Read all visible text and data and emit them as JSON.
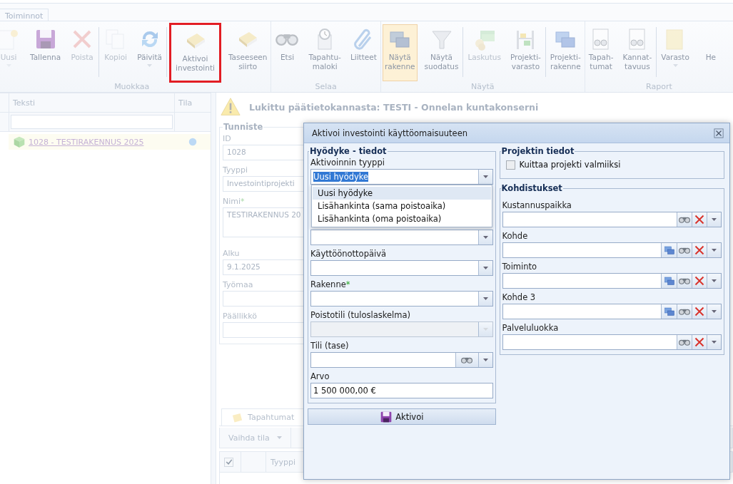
{
  "ribbon": {
    "tabs": [
      {
        "label": "Toiminnot",
        "selected": true
      }
    ],
    "groups": [
      {
        "label": "Muokkaa",
        "items": [
          {
            "label": "Uusi",
            "disabled": true,
            "selected": false,
            "dropdown": true
          },
          {
            "label": "Tallenna",
            "disabled": false,
            "selected": false
          },
          {
            "label": "Poista",
            "disabled": true,
            "selected": false
          },
          {
            "label": "Kopioi",
            "disabled": true,
            "selected": false,
            "separator_before": true
          },
          {
            "label": "Päivitä",
            "disabled": false,
            "selected": false,
            "dropdown": true
          },
          {
            "label": "Aktivoi\ninvestointi",
            "disabled": false,
            "selected": false,
            "separator_before": true,
            "highlighted": true
          },
          {
            "label": "Taseeseen\nsiirto",
            "disabled": false,
            "selected": false
          }
        ]
      },
      {
        "label": "Selaa",
        "items": [
          {
            "label": "Etsi",
            "disabled": false,
            "selected": false
          },
          {
            "label": "Tapahtu-\nmaloki",
            "disabled": false,
            "selected": false
          },
          {
            "label": "Liitteet",
            "disabled": false,
            "selected": false
          }
        ]
      },
      {
        "label": "Näytä",
        "items": [
          {
            "label": "Näytä\nrakenne",
            "disabled": false,
            "selected": true
          },
          {
            "label": "Näytä\nsuodatus",
            "disabled": false,
            "selected": false
          },
          {
            "label": "Laskutus",
            "disabled": true,
            "selected": false,
            "separator_before": true
          },
          {
            "label": "Projekti-\nvarasto",
            "disabled": false,
            "selected": false
          },
          {
            "label": "Projekti-\nrakenne",
            "disabled": false,
            "selected": false,
            "separator_before": true
          }
        ]
      },
      {
        "label": "Raport",
        "items": [
          {
            "label": "Tapah-\ntumat",
            "disabled": false,
            "selected": false
          },
          {
            "label": "Kannat-\ntavuus",
            "disabled": false,
            "selected": false
          },
          {
            "label": "Varasto",
            "disabled": false,
            "selected": false,
            "separator_before": true,
            "dropdown": true
          },
          {
            "label": "He",
            "disabled": false,
            "selected": false
          }
        ]
      }
    ]
  },
  "tree": {
    "columns": [
      "Teksti",
      "Tila"
    ],
    "rows": [
      {
        "text": "1028 - TESTIRAKENNUS 2025",
        "selected": true
      }
    ]
  },
  "details": {
    "notice": "Lukittu päätietokannasta: TESTI - Onnelan kuntakonserni",
    "section": {
      "title": "Tunniste",
      "fields": [
        {
          "kind": "text",
          "label": "ID",
          "value": "1028"
        },
        {
          "kind": "text",
          "label": "Tyyppi",
          "value": "Investointiprojekti"
        },
        {
          "kind": "textarea",
          "label": "Nimi",
          "required_mark": "*",
          "value": "TESTIRAKENNUS 20"
        },
        {
          "kind": "text",
          "label": "Alku",
          "value": "9.1.2025"
        },
        {
          "kind": "text",
          "label": "Työmaa"
        },
        {
          "kind": "text",
          "label": "Päällikkö"
        }
      ]
    },
    "tabs": [
      {
        "label": "Tapahtumat",
        "selected": true
      }
    ],
    "toolbar": [
      {
        "label": "Vaihda tila",
        "dropdown": true
      }
    ],
    "grid": {
      "header_checkbox": {
        "checked": true
      },
      "columns": [
        "Tyyppi"
      ]
    }
  },
  "dialog": {
    "title": "Aktivoi investointi käyttöomaisuuteen",
    "asset": {
      "title": "Hyödyke - tiedot",
      "fields": [
        {
          "kind": "combo",
          "label": "Aktivoinnin tyyppi",
          "value": "Uusi hyödyke",
          "text_selected": true,
          "disabled": false,
          "open": true,
          "options": [
            {
              "label": "Uusi hyödyke",
              "selected": true
            },
            {
              "label": "Lisähankinta (sama poistoaika)",
              "selected": false
            },
            {
              "label": "Lisähankinta (oma poistoaika)",
              "selected": false
            }
          ]
        },
        {
          "kind": "combo",
          "disabled": false
        },
        {
          "kind": "combo",
          "label": "Käyttöönottopäivä",
          "disabled": false
        },
        {
          "kind": "combo",
          "label": "Rakenne",
          "required_mark": "*",
          "disabled": false
        },
        {
          "kind": "combo",
          "label": "Poistotili (tuloslaskelma)",
          "disabled": true
        },
        {
          "kind": "search_combo",
          "label": "Tili (tase)",
          "disabled": false
        },
        {
          "kind": "text",
          "label": "Arvo",
          "value": "1 500 000,00 €"
        }
      ]
    },
    "submit": "Aktivoi",
    "project": {
      "title": "Projektin tiedot",
      "checkbox": {
        "label": "Kuittaa projekti valmiiksi",
        "checked": false
      }
    },
    "allocations": {
      "title": "Kohdistukset",
      "fields": [
        {
          "kind": "lookup",
          "label": "Kustannuspaikka"
        },
        {
          "kind": "tree_lookup",
          "label": "Kohde"
        },
        {
          "kind": "tree_lookup",
          "label": "Toiminto"
        },
        {
          "kind": "tree_lookup",
          "label": "Kohde 3"
        },
        {
          "kind": "lookup",
          "label": "Palveluluokka"
        }
      ]
    }
  }
}
